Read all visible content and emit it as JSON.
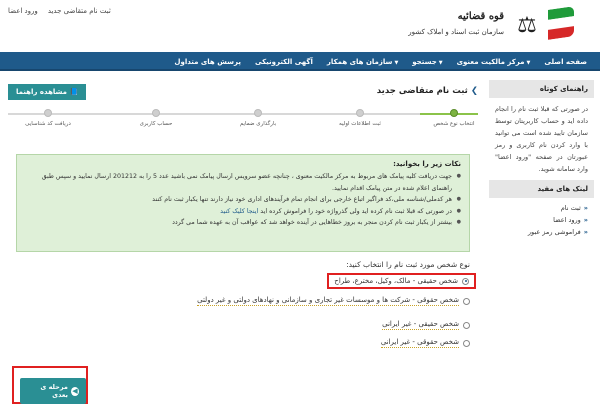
{
  "header": {
    "top_links": [
      "ورود اعضا",
      "ثبت نام متقاضی جدید"
    ],
    "logo_title": "قوه قضائیه",
    "logo_sub": "سازمان ثبت اسناد و املاک کشور"
  },
  "nav": {
    "items": [
      {
        "label": "صفحه اصلی",
        "caret": false
      },
      {
        "label": "مرکز مالکیت معنوی",
        "caret": true
      },
      {
        "label": "جستجو",
        "caret": true
      },
      {
        "label": "سازمان های همکار",
        "caret": true
      },
      {
        "label": "آگهی الکترونیکی",
        "caret": false
      },
      {
        "label": "پرسش های متداول",
        "caret": false
      }
    ]
  },
  "sidebar": {
    "guide_title": "راهنمای کوتاه",
    "guide_text": "در صورتی که قبلا ثبت نام را انجام داده اید و حساب کاربریتان توسط سازمان تایید شده است می توانید با وارد کردن نام کاربری و رمز عبورتان در صفحه \"ورود اعضا\" وارد سامانه شوید.",
    "links_title": "لینک های مفید",
    "links": [
      "ثبت نام",
      "ورود اعضا",
      "فراموشی رمز عبور"
    ]
  },
  "main": {
    "title": "ثبت نام متقاضی جدید",
    "help_button": "مشاهده راهنما",
    "steps": [
      "انتخاب نوع شخص",
      "ثبت اطلاعات اولیه",
      "بارگذاری ضمایم",
      "حساب کاربری",
      "دریافت کد شناسایی"
    ],
    "notice_title": "نکات زیر را بخوانید:",
    "notice_items": [
      "جهت دریافت کلیه پیامک های مربوط به مرکز مالکیت معنوی ، چنانچه عضو سرویس ارسال پیامک نمی باشید عدد 5 را به 201212 ارسال نمایید و سپس طبق راهنمای اعلام شده در متن پیامک اقدام نمایید.",
      "هر کدملی/شناسه ملی،کد فراگیر اتباع خارجی برای انجام تمام فرآیندهای اداری خود نیاز دارند تنها یکبار ثبت نام کنند",
      "در صورتی که قبلا ثبت نام کرده اید ولی گذرواژه خود را فراموش کرده اید",
      "اینجا کلیک کنید",
      "بیشتر از یکبار ثبت نام کردن منجر به بروز خطاهایی در آینده خواهد شد که عواقب آن به عهده شما می گردد"
    ],
    "question": "نوع شخص مورد ثبت نام را انتخاب کنید:",
    "options": [
      "شخص حقیقی - مالک، وکیل، مخترع، طراح",
      "شخص حقوقی - شرکت ها و موسسات غیر تجاری و سازمانی و نهادهای دولتی و غیر دولتی",
      "شخص حقیقی - غیر ایرانی",
      "شخص حقوقی - غیر ایرانی"
    ],
    "next_button": "مرحله ی بعدی"
  }
}
